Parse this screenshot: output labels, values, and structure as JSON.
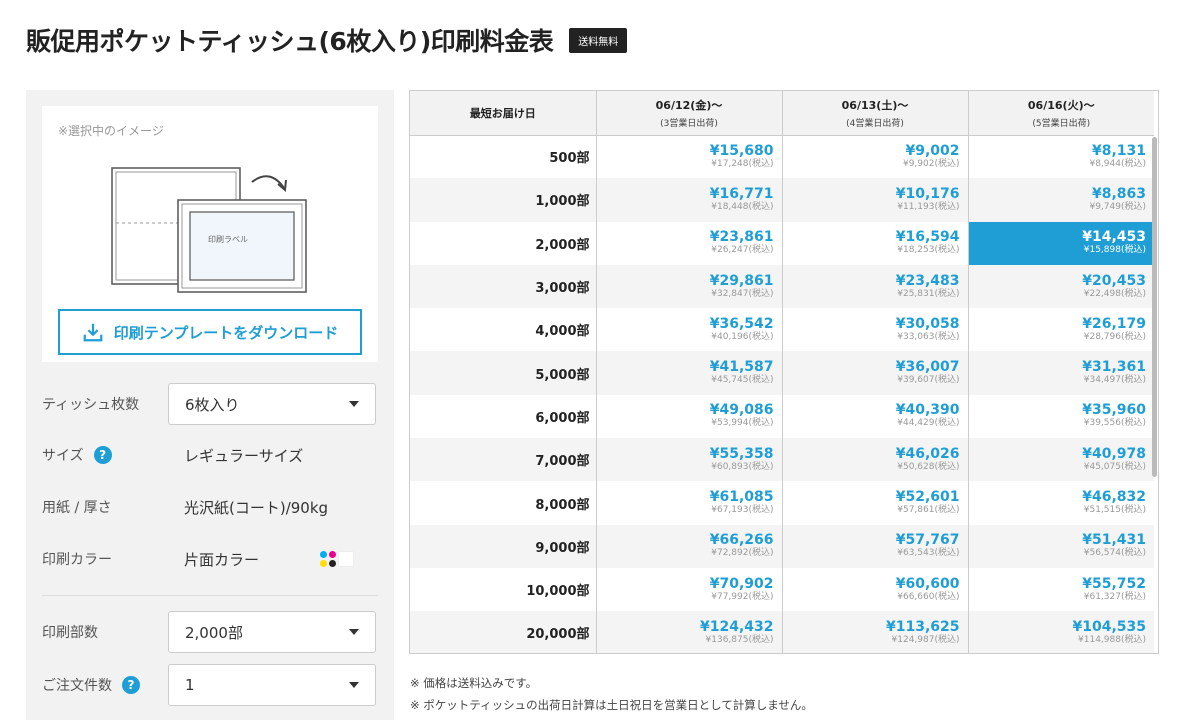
{
  "header": {
    "title": "販促用ポケットティッシュ(6枚入り)印刷料金表",
    "badge": "送料無料"
  },
  "preview": {
    "caption": "※選択中のイメージ",
    "label_text": "印刷ラベル",
    "download_label": "印刷テンプレートをダウンロード"
  },
  "options": {
    "tissue_count": {
      "label": "ティッシュ枚数",
      "value": "6枚入り"
    },
    "size": {
      "label": "サイズ",
      "value": "レギュラーサイズ"
    },
    "paper": {
      "label": "用紙 / 厚さ",
      "value": "光沢紙(コート)/90kg"
    },
    "color": {
      "label": "印刷カラー",
      "value": "片面カラー"
    },
    "quantity": {
      "label": "印刷部数",
      "value": "2,000部"
    },
    "order_count": {
      "label": "ご注文件数",
      "value": "1"
    }
  },
  "colors": {
    "accent": "#1f9ed6",
    "cmyk": [
      "#00aeef",
      "#ec008c",
      "#ffde00",
      "#222222"
    ]
  },
  "table": {
    "corner_label": "最短お届け日",
    "columns": [
      {
        "date": "06/12(金)〜",
        "note": "(3営業日出荷)"
      },
      {
        "date": "06/13(土)〜",
        "note": "(4営業日出荷)"
      },
      {
        "date": "06/16(火)〜",
        "note": "(5営業日出荷)"
      }
    ],
    "rows": [
      {
        "qty": "500部",
        "cells": [
          [
            "¥15,680",
            "¥17,248(税込)"
          ],
          [
            "¥9,002",
            "¥9,902(税込)"
          ],
          [
            "¥8,131",
            "¥8,944(税込)"
          ]
        ]
      },
      {
        "qty": "1,000部",
        "cells": [
          [
            "¥16,771",
            "¥18,448(税込)"
          ],
          [
            "¥10,176",
            "¥11,193(税込)"
          ],
          [
            "¥8,863",
            "¥9,749(税込)"
          ]
        ]
      },
      {
        "qty": "2,000部",
        "cells": [
          [
            "¥23,861",
            "¥26,247(税込)"
          ],
          [
            "¥16,594",
            "¥18,253(税込)"
          ],
          [
            "¥14,453",
            "¥15,898(税込)"
          ]
        ]
      },
      {
        "qty": "3,000部",
        "cells": [
          [
            "¥29,861",
            "¥32,847(税込)"
          ],
          [
            "¥23,483",
            "¥25,831(税込)"
          ],
          [
            "¥20,453",
            "¥22,498(税込)"
          ]
        ]
      },
      {
        "qty": "4,000部",
        "cells": [
          [
            "¥36,542",
            "¥40,196(税込)"
          ],
          [
            "¥30,058",
            "¥33,063(税込)"
          ],
          [
            "¥26,179",
            "¥28,796(税込)"
          ]
        ]
      },
      {
        "qty": "5,000部",
        "cells": [
          [
            "¥41,587",
            "¥45,745(税込)"
          ],
          [
            "¥36,007",
            "¥39,607(税込)"
          ],
          [
            "¥31,361",
            "¥34,497(税込)"
          ]
        ]
      },
      {
        "qty": "6,000部",
        "cells": [
          [
            "¥49,086",
            "¥53,994(税込)"
          ],
          [
            "¥40,390",
            "¥44,429(税込)"
          ],
          [
            "¥35,960",
            "¥39,556(税込)"
          ]
        ]
      },
      {
        "qty": "7,000部",
        "cells": [
          [
            "¥55,358",
            "¥60,893(税込)"
          ],
          [
            "¥46,026",
            "¥50,628(税込)"
          ],
          [
            "¥40,978",
            "¥45,075(税込)"
          ]
        ]
      },
      {
        "qty": "8,000部",
        "cells": [
          [
            "¥61,085",
            "¥67,193(税込)"
          ],
          [
            "¥52,601",
            "¥57,861(税込)"
          ],
          [
            "¥46,832",
            "¥51,515(税込)"
          ]
        ]
      },
      {
        "qty": "9,000部",
        "cells": [
          [
            "¥66,266",
            "¥72,892(税込)"
          ],
          [
            "¥57,767",
            "¥63,543(税込)"
          ],
          [
            "¥51,431",
            "¥56,574(税込)"
          ]
        ]
      },
      {
        "qty": "10,000部",
        "cells": [
          [
            "¥70,902",
            "¥77,992(税込)"
          ],
          [
            "¥60,600",
            "¥66,660(税込)"
          ],
          [
            "¥55,752",
            "¥61,327(税込)"
          ]
        ]
      },
      {
        "qty": "20,000部",
        "cells": [
          [
            "¥124,432",
            "¥136,875(税込)"
          ],
          [
            "¥113,625",
            "¥124,987(税込)"
          ],
          [
            "¥104,535",
            "¥114,988(税込)"
          ]
        ]
      }
    ],
    "selected": {
      "row": 2,
      "col": 2
    }
  },
  "notes": [
    "※ 価格は送料込みです。",
    "※ ポケットティッシュの出荷日計算は土日祝日を営業日として計算しません。"
  ]
}
